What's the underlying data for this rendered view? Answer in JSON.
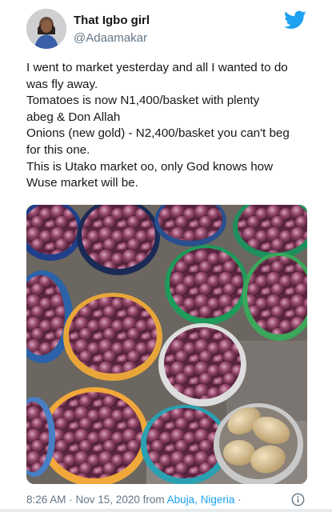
{
  "user": {
    "display_name": "That Igbo girl",
    "handle": "@Adaamakar"
  },
  "tweet": {
    "lines": [
      "I went to market yesterday and all I wanted to do",
      "was fly away.",
      "Tomatoes is now N1,400/basket with plenty",
      "abeg & Don Allah",
      "Onions (new gold) - N2,400/basket you can't beg",
      "for this one.",
      "This is Utako market oo, only God knows how",
      "Wuse market will be."
    ]
  },
  "meta": {
    "time": "8:26 AM",
    "separator1": " · ",
    "date": "Nov 15, 2020",
    "from": " from ",
    "location": "Abuja, Nigeria",
    "separator2": " · "
  },
  "icons": {
    "brand": "twitter-bird-icon",
    "info": "info-icon"
  },
  "colors": {
    "brand_blue": "#1da1f2",
    "text": "#14171a",
    "secondary": "#657786",
    "onion_purple": "#8a3a5e"
  }
}
